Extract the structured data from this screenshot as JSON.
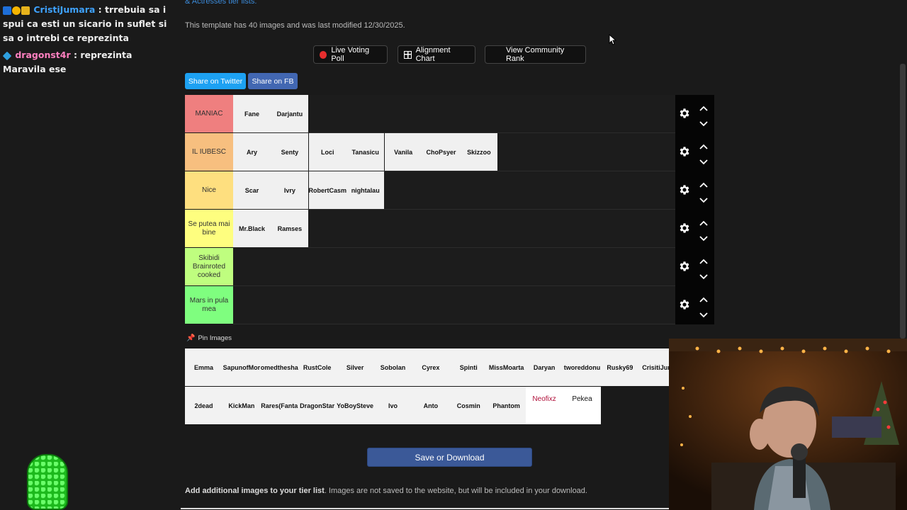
{
  "chat": {
    "messages": [
      {
        "user": "CristiJumara",
        "text": " : trrebuia sa i spui ca esti un sicario in suflet si sa o intrebi ce reprezinta"
      },
      {
        "user": "dragonst4r",
        "text": " : reprezinta Maravila ese"
      }
    ]
  },
  "header": {
    "top_link": "& Actresses tier lists.",
    "description": "This template has 40 images and was last modified 12/30/2025."
  },
  "actions": {
    "live_voting": "Live Voting Poll",
    "alignment_chart": "Alignment Chart",
    "community_rank": "View Community Rank",
    "share_twitter": "Share on Twitter",
    "share_fb": "Share on FB"
  },
  "tiers": [
    {
      "label": "MANIAC",
      "color": "#ef7f7f",
      "items": [
        "Fane",
        "Darjantu"
      ]
    },
    {
      "label": "IL IUBESC",
      "color": "#f7bf7f",
      "items": [
        "Ary",
        "Senty",
        "Loci",
        "Tanasicu",
        "Vanila",
        "ChoPsyer",
        "Skizzoo"
      ]
    },
    {
      "label": "Nice",
      "color": "#fedf7f",
      "items": [
        "Scar",
        "Ivry",
        "RobertCasm",
        "nightalau"
      ]
    },
    {
      "label": "Se putea mai bine",
      "color": "#fefe7f",
      "items": [
        "Mr.Black",
        "Ramses"
      ]
    },
    {
      "label": "Skibidi Brainroted cooked",
      "color": "#bffe7f",
      "items": []
    },
    {
      "label": "Mars in pula mea",
      "color": "#7ffe7f",
      "items": []
    }
  ],
  "pool": {
    "pin_label": "Pin Images",
    "row1": [
      "Emma",
      "SapunofMor",
      "omedthesha",
      "RustCole",
      "Silver",
      "Sobolan",
      "Cyrex",
      "Spinti",
      "MissMoarta",
      "Daryan",
      "tworeddonu",
      "Rusky69",
      "CrisitiJum"
    ],
    "row2": [
      "2dead",
      "KickMan",
      "Rares(Fanta",
      "DragonStar",
      "YoBoySteve",
      "Ivo",
      "Anto",
      "Cosmin",
      "Phantom",
      "Neofixz",
      "Pekea"
    ]
  },
  "save_label": "Save or Download",
  "footnote": {
    "bold": "Add additional images to your tier list",
    "rest": ". Images are not saved to the website, but will be included in your download."
  },
  "colors": {
    "twitter": "#1da1f2",
    "fb": "#4267b2",
    "save": "#3b5998"
  }
}
